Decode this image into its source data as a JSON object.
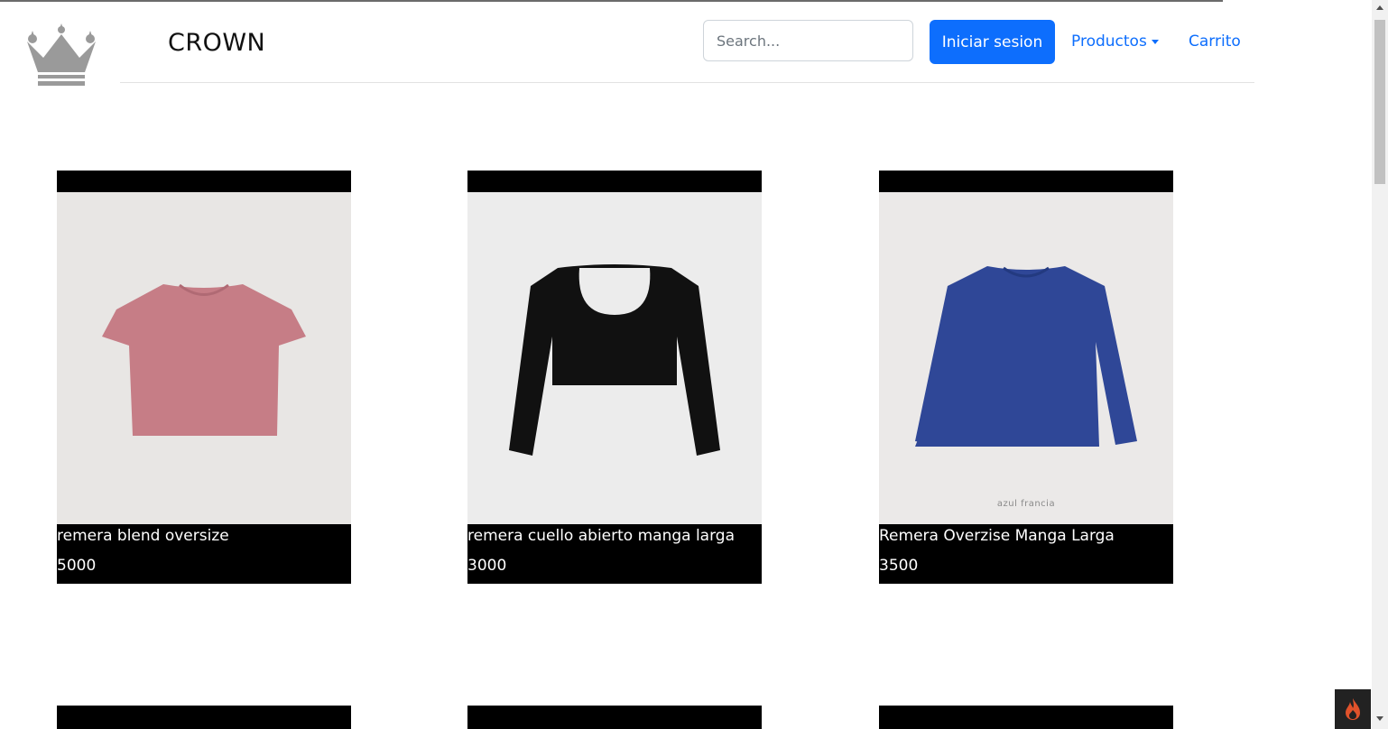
{
  "brand": {
    "name": "CROWN"
  },
  "header": {
    "search_placeholder": "Search...",
    "login_label": "Iniciar sesion",
    "products_label": "Productos",
    "cart_label": "Carrito"
  },
  "products": [
    {
      "name": "remera blend oversize",
      "price": "5000",
      "color": "#c67d86"
    },
    {
      "name": "remera cuello abierto manga larga",
      "price": "3000",
      "color": "#111111"
    },
    {
      "name": "Remera Overzise Manga Larga",
      "price": "3500",
      "color": "#2f4797",
      "image_caption": "azul francia"
    }
  ],
  "colors": {
    "accent": "#0d6efd",
    "card_bg": "#000000"
  }
}
